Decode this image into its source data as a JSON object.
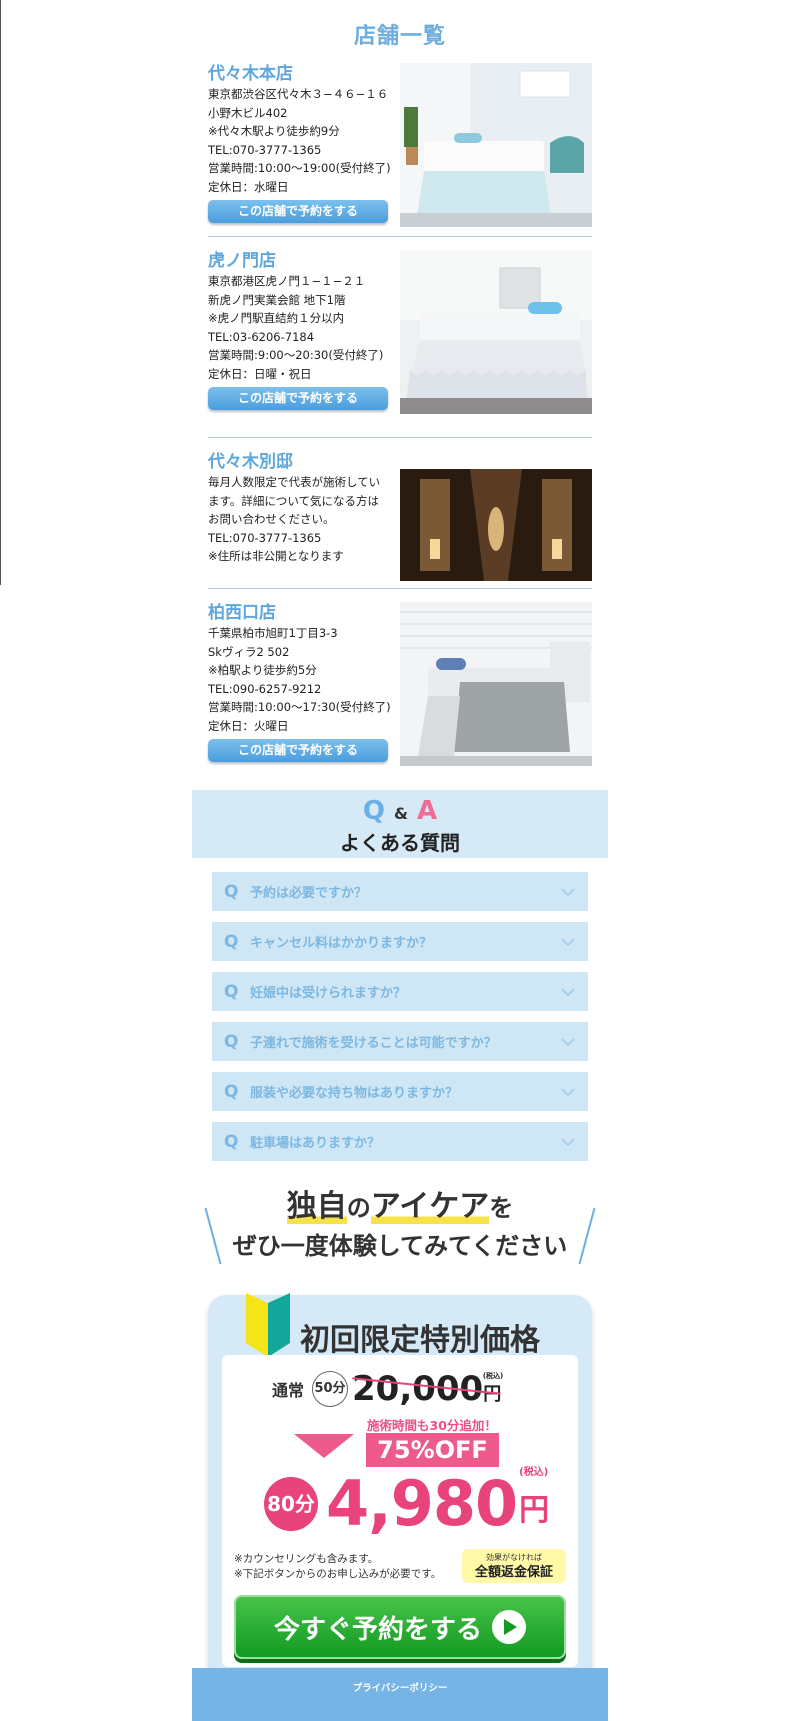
{
  "stores_section": {
    "title": "店舗一覧",
    "reserve_label": "この店舗で予約をする",
    "stores": [
      {
        "name": "代々木本店",
        "lines": [
          "東京都渋谷区代々木３−４６−１６",
          "小野木ビル402",
          "※代々木駅より徒歩約9分",
          "TEL:070-3777-1365",
          "営業時間:10:00〜19:00(受付終了)",
          "定休日：水曜日"
        ]
      },
      {
        "name": "虎ノ門店",
        "lines": [
          "東京都港区虎ノ門１−１−２１",
          "新虎ノ門実業会館 地下1階",
          "※虎ノ門駅直結約１分以内",
          "TEL:03-6206-7184",
          "営業時間:9:00〜20:30(受付終了)",
          "定休日：日曜・祝日"
        ]
      },
      {
        "name": "代々木別邸",
        "lines": [
          "毎月人数限定で代表が施術してい",
          "ます。詳細について気になる方は",
          "お問い合わせください。",
          "TEL:070-3777-1365",
          "※住所は非公開となります"
        ]
      },
      {
        "name": "柏西口店",
        "lines": [
          "千葉県柏市旭町1丁目3-3",
          "Skヴィラ2 502",
          "※柏駅より徒歩約5分",
          "TEL:090-6257-9212",
          "営業時間:10:00〜17:30(受付終了)",
          "定休日：火曜日"
        ]
      }
    ]
  },
  "qa": {
    "q": "Q",
    "amp": "&",
    "a": "A",
    "subtitle": "よくある質問",
    "q_mark": "Q",
    "questions": [
      "予約は必要ですか？",
      "キャンセル料はかかりますか？",
      "妊娠中は受けられますか？",
      "子連れで施術を受けることは可能ですか？",
      "服装や必要な持ち物はありますか？",
      "駐車場はありますか？"
    ]
  },
  "cta": {
    "line1_a": "独自",
    "line1_b": "の",
    "line1_c": "アイケア",
    "line1_d": "を",
    "line2": "ぜひ一度体験してみてください",
    "offer_title": "初回限定特別価格",
    "regular_label": "通常",
    "regular_minutes": "50分",
    "regular_price": "20,000",
    "yen": "円",
    "tax_small": "(税込)",
    "extra_time": "施術時間も30分追加！",
    "discount": "75%OFF",
    "new_minutes": "80分",
    "new_price": "4,980",
    "tax": "(税込)",
    "note1": "※カウンセリングも含みます。",
    "note2": "※下記ボタンからのお申し込みが必要です。",
    "guarantee_small": "効果がなければ",
    "guarantee_big": "全額返金保証",
    "button_label": "今すぐ予約をする"
  },
  "footer": {
    "privacy": "プライバシーポリシー"
  },
  "colors": {
    "accent_blue": "#6eaedc",
    "light_blue": "#d6e9f6",
    "pink": "#e9437c",
    "green": "#139a22"
  }
}
